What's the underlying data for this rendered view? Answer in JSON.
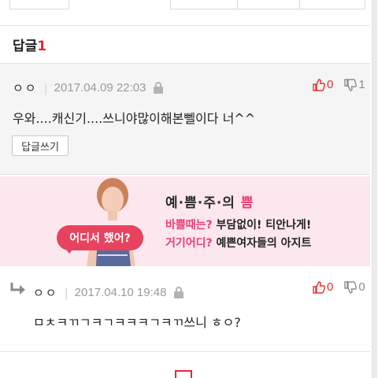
{
  "reply_section": {
    "title": "답글",
    "count": "1"
  },
  "comments": [
    {
      "author": "ㅇㅇ",
      "separator": "|",
      "date": "2017.04.09 22:03",
      "upvotes": "0",
      "downvotes": "1",
      "text": "우와....캐신기....쓰니야많이해본뻴이다 너^^",
      "reply_button": "답글쓰기"
    },
    {
      "author": "ㅇㅇ",
      "separator": "|",
      "date": "2017.04.10 19:48",
      "upvotes": "0",
      "downvotes": "0",
      "text": "ㅁㅊㅋㄲㄱㅋㄱㅋㅋㅋㄱㅋㄲ쓰니 ㅎㅇ?"
    }
  ],
  "ad": {
    "title_part1": "예·쁨·주·의 ",
    "title_part2": "쁨",
    "line1_pink": "바쁠때는?",
    "line1_black": " 부담없이! 티안나게!",
    "line2_pink": "거기어디?",
    "line2_black": " 예쁜여자들의 아지트",
    "bubble_text": "어디서 했어?"
  },
  "colors": {
    "accent_red": "#e4293b",
    "ad_pink": "#e93e73",
    "ad_bg": "#fde7ee"
  }
}
